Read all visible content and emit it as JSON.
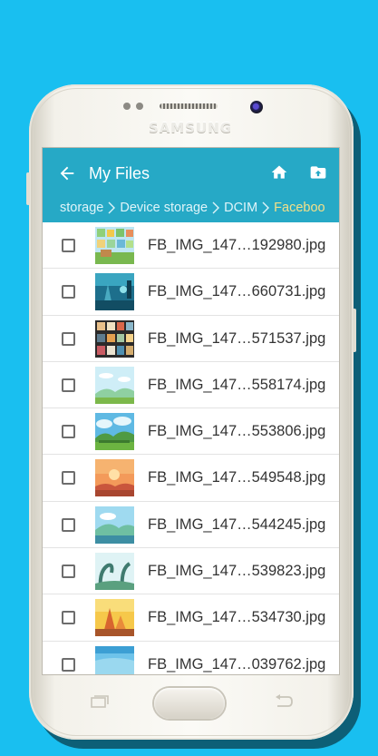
{
  "device": {
    "brand": "SAMSUNG"
  },
  "appbar": {
    "title": "My Files",
    "back_icon": "arrow-left-icon",
    "home_icon": "home-icon",
    "upload_icon": "folder-upload-icon",
    "color": "#26a9c6"
  },
  "breadcrumb": {
    "items": [
      "storage",
      "Device storage",
      "DCIM",
      "Faceboo"
    ],
    "current_color": "#f3e089"
  },
  "files": [
    {
      "name": "FB_IMG_147…192980.jpg",
      "checked": false
    },
    {
      "name": "FB_IMG_147…660731.jpg",
      "checked": false
    },
    {
      "name": "FB_IMG_147…571537.jpg",
      "checked": false
    },
    {
      "name": "FB_IMG_147…558174.jpg",
      "checked": false
    },
    {
      "name": "FB_IMG_147…553806.jpg",
      "checked": false
    },
    {
      "name": "FB_IMG_147…549548.jpg",
      "checked": false
    },
    {
      "name": "FB_IMG_147…544245.jpg",
      "checked": false
    },
    {
      "name": "FB_IMG_147…539823.jpg",
      "checked": false
    },
    {
      "name": "FB_IMG_147…534730.jpg",
      "checked": false
    },
    {
      "name": "FB_IMG_147…039762.jpg",
      "checked": false
    }
  ],
  "background_color": "#19bff0"
}
